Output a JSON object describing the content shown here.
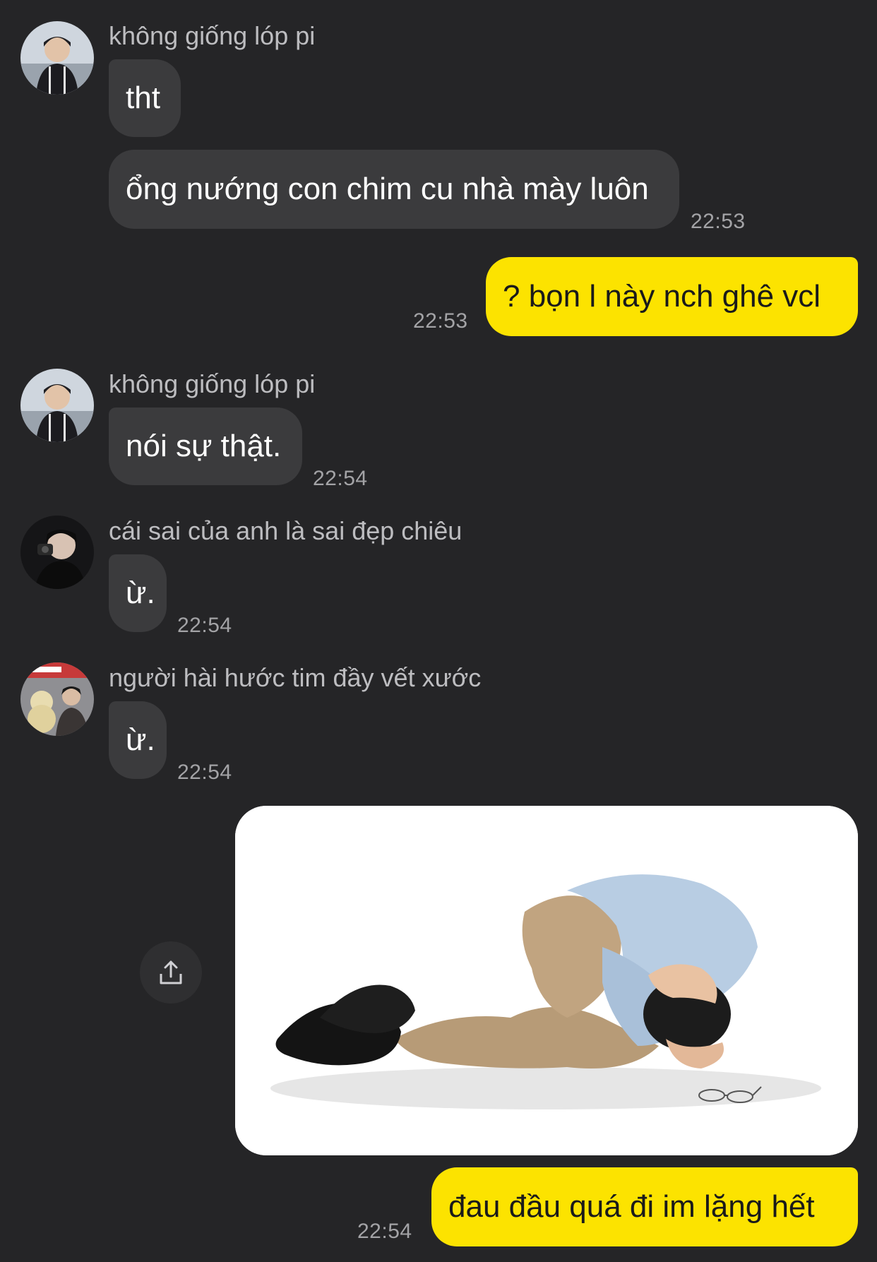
{
  "messages": [
    {
      "sender": "không giống lóp pi",
      "lines": [
        "tht",
        "ổng nướng con chim cu nhà mày luôn"
      ],
      "time": "22:53"
    },
    {
      "mine": true,
      "text": "? bọn l này nch ghê vcl",
      "time": "22:53"
    },
    {
      "sender": "không giống lóp pi",
      "lines": [
        "nói sự thật."
      ],
      "time": "22:54"
    },
    {
      "sender": "cái sai của anh là sai đẹp chiêu",
      "lines": [
        "ừ."
      ],
      "time": "22:54"
    },
    {
      "sender": "người hài hước tim đầy vết xước",
      "lines": [
        "ừ."
      ],
      "time": "22:54"
    },
    {
      "mine": true,
      "image": "photo-man-curled-on-floor-holding-head",
      "caption": "đau đầu quá đi im lặng hết",
      "time": "22:54"
    }
  ],
  "icons": {
    "share": "share-icon"
  },
  "colors": {
    "background": "#252527",
    "incoming_bubble": "#3b3b3d",
    "outgoing_bubble": "#fce300",
    "timestamp": "#a3a3a6"
  }
}
